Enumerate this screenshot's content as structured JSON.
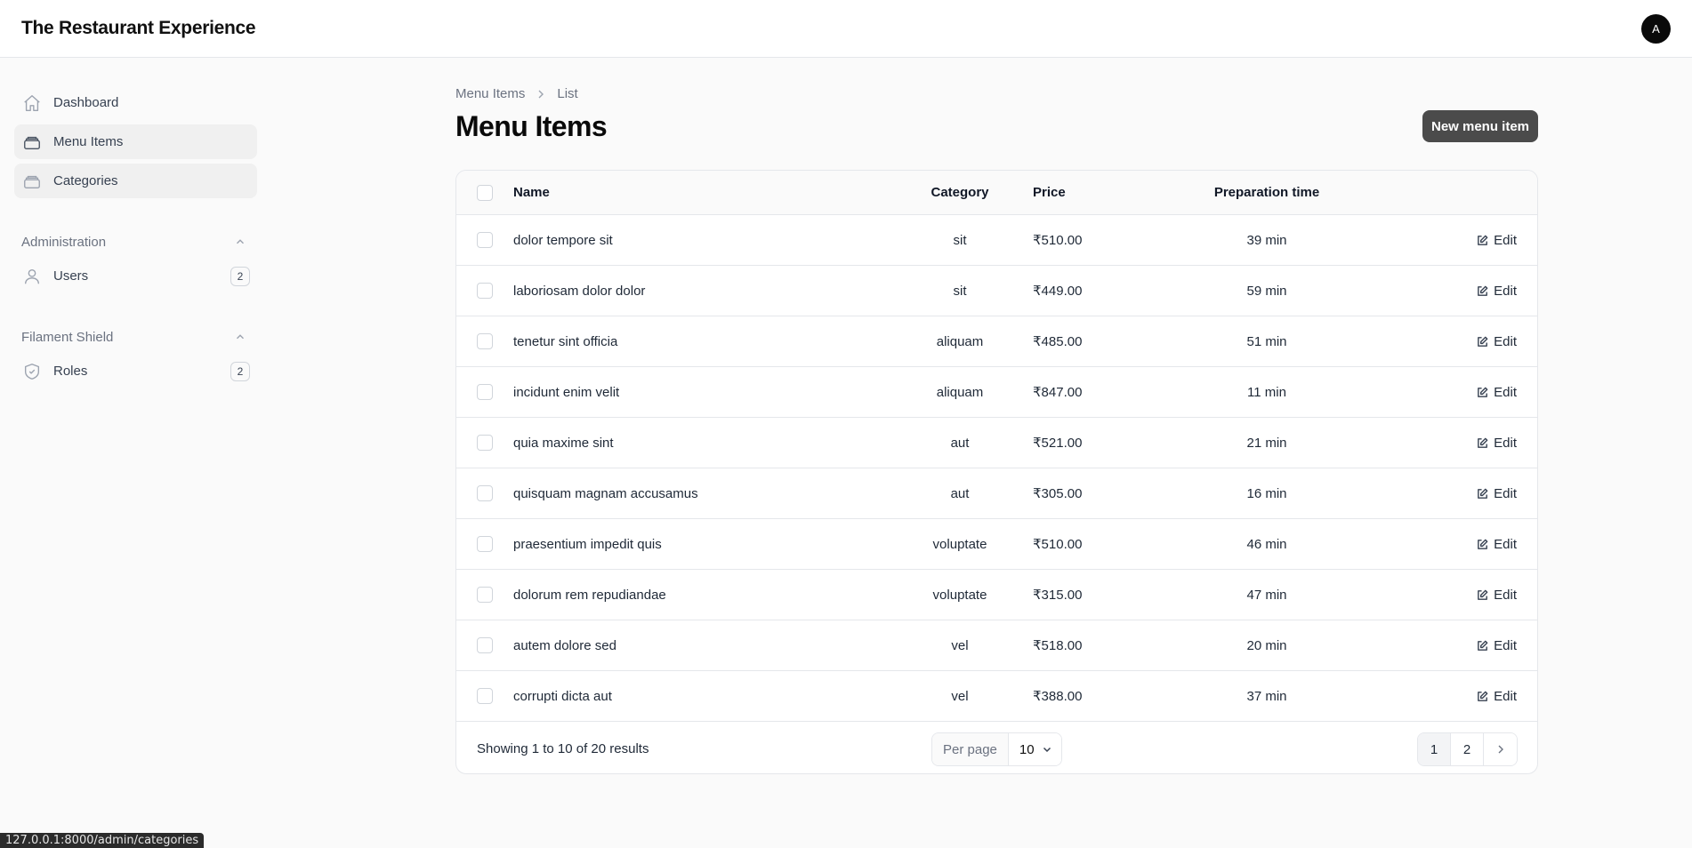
{
  "app": {
    "brand": "The Restaurant Experience",
    "avatar_initial": "A"
  },
  "sidebar": {
    "items": [
      {
        "label": "Dashboard",
        "icon": "home-icon"
      },
      {
        "label": "Menu Items",
        "icon": "stack-icon"
      },
      {
        "label": "Categories",
        "icon": "stack-icon"
      }
    ],
    "groups": [
      {
        "label": "Administration",
        "items": [
          {
            "label": "Users",
            "badge": "2",
            "icon": "user-icon"
          }
        ]
      },
      {
        "label": "Filament Shield",
        "items": [
          {
            "label": "Roles",
            "badge": "2",
            "icon": "shield-check-icon"
          }
        ]
      }
    ]
  },
  "breadcrumb": {
    "parent": "Menu Items",
    "current": "List"
  },
  "page": {
    "title": "Menu Items",
    "new_button": "New menu item"
  },
  "table": {
    "columns": {
      "name": "Name",
      "category": "Category",
      "price": "Price",
      "prep": "Preparation time"
    },
    "edit_label": "Edit",
    "rows": [
      {
        "name": "dolor tempore sit",
        "category": "sit",
        "price": "₹510.00",
        "prep": "39 min"
      },
      {
        "name": "laboriosam dolor dolor",
        "category": "sit",
        "price": "₹449.00",
        "prep": "59 min"
      },
      {
        "name": "tenetur sint officia",
        "category": "aliquam",
        "price": "₹485.00",
        "prep": "51 min"
      },
      {
        "name": "incidunt enim velit",
        "category": "aliquam",
        "price": "₹847.00",
        "prep": "11 min"
      },
      {
        "name": "quia maxime sint",
        "category": "aut",
        "price": "₹521.00",
        "prep": "21 min"
      },
      {
        "name": "quisquam magnam accusamus",
        "category": "aut",
        "price": "₹305.00",
        "prep": "16 min"
      },
      {
        "name": "praesentium impedit quis",
        "category": "voluptate",
        "price": "₹510.00",
        "prep": "46 min"
      },
      {
        "name": "dolorum rem repudiandae",
        "category": "voluptate",
        "price": "₹315.00",
        "prep": "47 min"
      },
      {
        "name": "autem dolore sed",
        "category": "vel",
        "price": "₹518.00",
        "prep": "20 min"
      },
      {
        "name": "corrupti dicta aut",
        "category": "vel",
        "price": "₹388.00",
        "prep": "37 min"
      }
    ]
  },
  "footer": {
    "showing": "Showing 1 to 10 of 20 results",
    "per_page_label": "Per page",
    "per_page_value": "10",
    "pages": [
      "1",
      "2"
    ]
  },
  "status_url": "127.0.0.1:8000/admin/categories"
}
